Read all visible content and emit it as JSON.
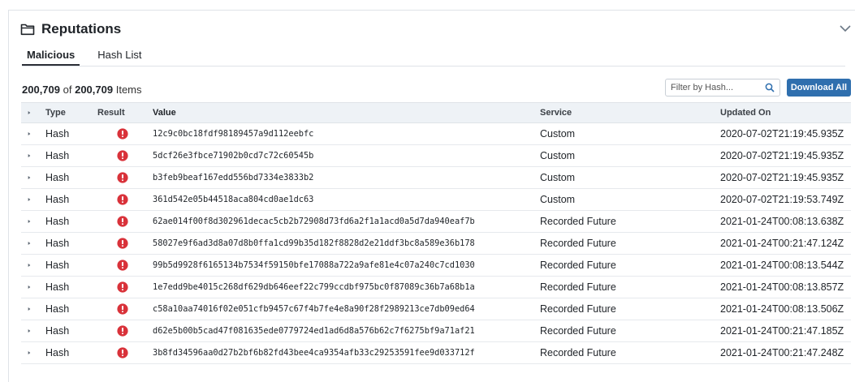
{
  "panel": {
    "title": "Reputations",
    "icons": {
      "title_icon": "folder-icon",
      "collapse": "chevron-down-icon"
    }
  },
  "tabs": [
    {
      "label": "Malicious",
      "active": true
    },
    {
      "label": "Hash List",
      "active": false
    }
  ],
  "count": {
    "shown": "200,709",
    "of": "of",
    "total": "200,709",
    "unit": "Items"
  },
  "filter": {
    "placeholder": "Filter by Hash..."
  },
  "download_label": "Download All",
  "colors": {
    "accent": "#2f6fae",
    "alert": "#d9323a",
    "header_bg": "#eef2f6"
  },
  "columns": [
    "Type",
    "Result",
    "Value",
    "Service",
    "Updated On"
  ],
  "rows": [
    {
      "type": "Hash",
      "value": "12c9c0bc18fdf98189457a9d112eebfc",
      "service": "Custom",
      "updated": "2020-07-02T21:19:45.935Z"
    },
    {
      "type": "Hash",
      "value": "5dcf26e3fbce71902b0cd7c72c60545b",
      "service": "Custom",
      "updated": "2020-07-02T21:19:45.935Z"
    },
    {
      "type": "Hash",
      "value": "b3feb9beaf167edd556bd7334e3833b2",
      "service": "Custom",
      "updated": "2020-07-02T21:19:45.935Z"
    },
    {
      "type": "Hash",
      "value": "361d542e05b44518aca804cd0ae1dc63",
      "service": "Custom",
      "updated": "2020-07-02T21:19:53.749Z"
    },
    {
      "type": "Hash",
      "value": "62ae014f00f8d302961decac5cb2b72908d73fd6a2f1a1acd0a5d7da940eaf7b",
      "service": "Recorded Future",
      "updated": "2021-01-24T00:08:13.638Z"
    },
    {
      "type": "Hash",
      "value": "58027e9f6ad3d8a07d8b0ffa1cd99b35d182f8828d2e21ddf3bc8a589e36b178",
      "service": "Recorded Future",
      "updated": "2021-01-24T00:21:47.124Z"
    },
    {
      "type": "Hash",
      "value": "99b5d9928f6165134b7534f59150bfe17088a722a9afe81e4c07a240c7cd1030",
      "service": "Recorded Future",
      "updated": "2021-01-24T00:08:13.544Z"
    },
    {
      "type": "Hash",
      "value": "1e7edd9be4015c268df629db646eef22c799ccdbf975bc0f87089c36b7a68b1a",
      "service": "Recorded Future",
      "updated": "2021-01-24T00:08:13.857Z"
    },
    {
      "type": "Hash",
      "value": "c58a10aa74016f02e051cfb9457c67f4b7fe4e8a90f28f2989213ce7db09ed64",
      "service": "Recorded Future",
      "updated": "2021-01-24T00:08:13.506Z"
    },
    {
      "type": "Hash",
      "value": "d62e5b00b5cad47f081635ede0779724ed1ad6d8a576b62c7f6275bf9a71af21",
      "service": "Recorded Future",
      "updated": "2021-01-24T00:21:47.185Z"
    },
    {
      "type": "Hash",
      "value": "3b8fd34596aa0d27b2bf6b82fd43bee4ca9354afb33c29253591fee9d033712f",
      "service": "Recorded Future",
      "updated": "2021-01-24T00:21:47.248Z"
    }
  ]
}
